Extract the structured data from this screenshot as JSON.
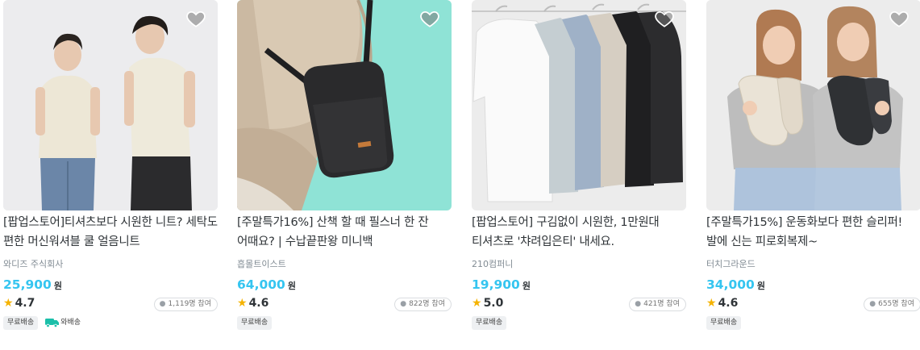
{
  "products": [
    {
      "title": "[팝업스토어]티셔츠보다 시원한 니트? 세탁도 편한 머신워셔블 쿨 얼음니트",
      "brand": "와디즈 주식회사",
      "price": "25,900",
      "currency": "원",
      "rating": "4.7",
      "participants": "1,119명 참여",
      "badges": [
        "무료배송"
      ],
      "today_delivery": "와배송",
      "image_icon": "couple-in-knit-shirts"
    },
    {
      "title": "[주말특가16%] 산책 할 때 필스너 한 잔 어때요? | 수납끝판왕 미니백",
      "brand": "흡몰트이스트",
      "price": "64,000",
      "currency": "원",
      "rating": "4.6",
      "participants": "822명 참여",
      "badges": [
        "무료배송"
      ],
      "image_icon": "black-crossbody-mini-bag"
    },
    {
      "title": "[팝업스토어] 구김없이 시원한, 1만원대 티셔츠로 '챠려입은티' 내세요.",
      "brand": "210컴퍼니",
      "price": "19,900",
      "currency": "원",
      "rating": "5.0",
      "participants": "421명 참여",
      "badges": [
        "무료배송"
      ],
      "image_icon": "t-shirts-on-hangers"
    },
    {
      "title": "[주말특가15%] 운동화보다 편한 슬리퍼! 발에 신는 피로회복제~",
      "brand": "터치그라운드",
      "price": "34,000",
      "currency": "원",
      "rating": "4.6",
      "participants": "655명 참여",
      "badges": [
        "무료배송"
      ],
      "image_icon": "women-holding-slippers"
    }
  ],
  "colors": {
    "accent_price": "#35c5f0",
    "star": "#f5b300",
    "today_delivery": "#1bbfa9"
  }
}
